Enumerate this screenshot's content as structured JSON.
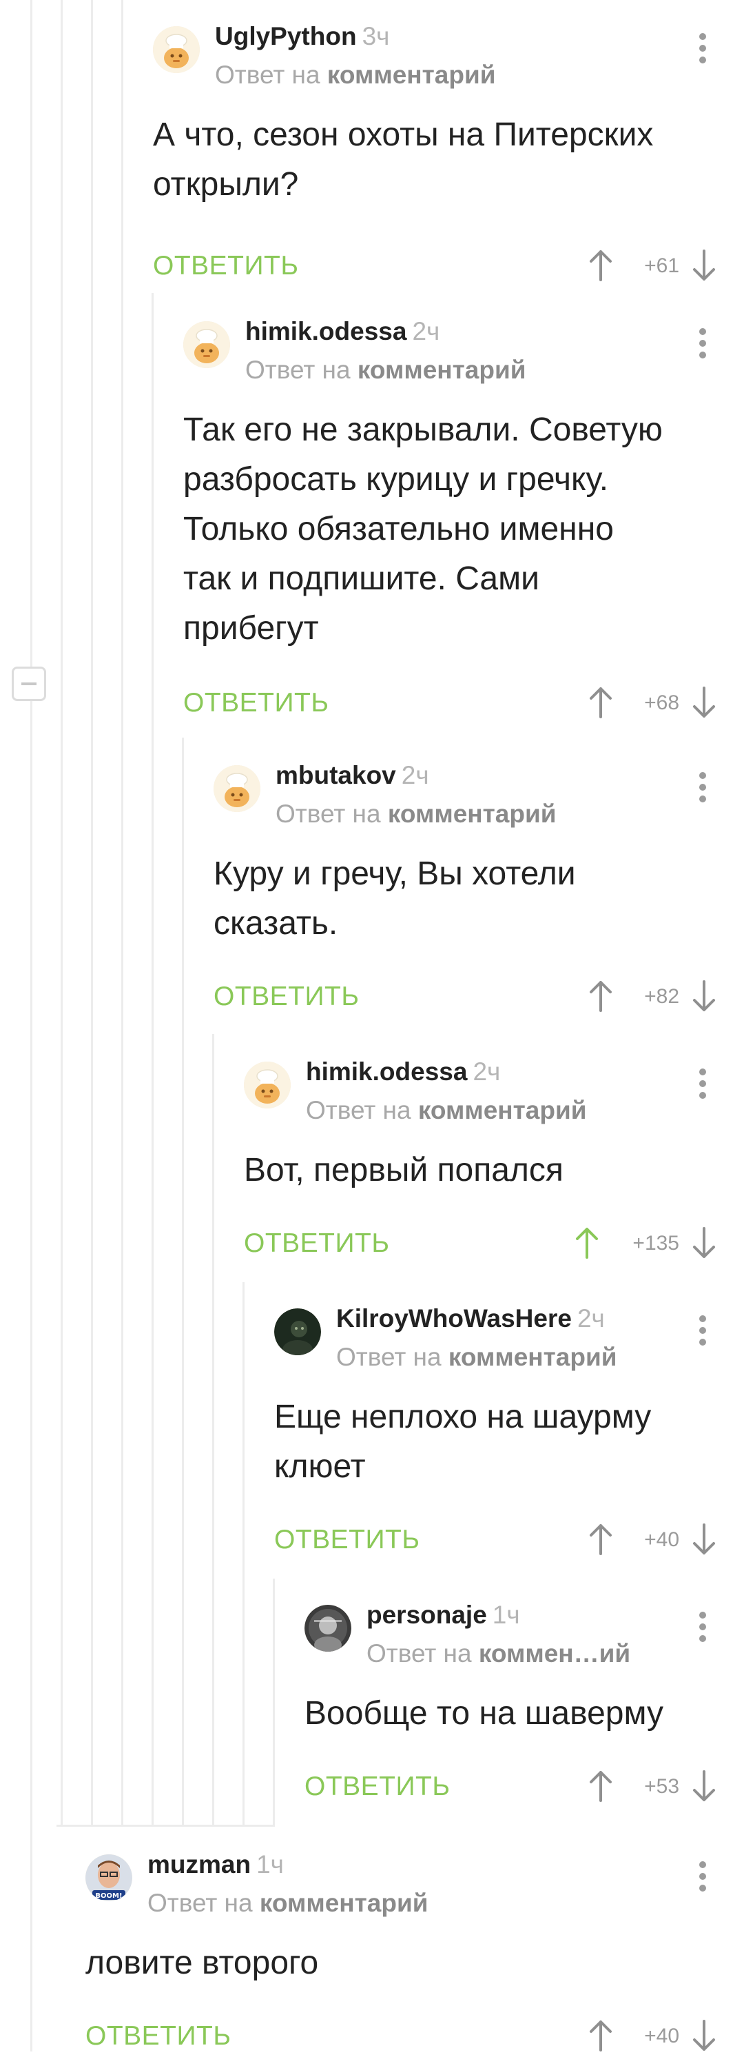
{
  "comments": [
    {
      "author": "UglyPython",
      "time": "3ч",
      "reply_prefix": "Ответ на",
      "reply_target": "комментарий",
      "lines": [
        "А что, сезон охоты на Питерских",
        "открыли?"
      ],
      "answer": "ОТВЕТИТЬ",
      "rating": "+61",
      "upvoted": false
    },
    {
      "author": "himik.odessa",
      "time": "2ч",
      "reply_prefix": "Ответ на",
      "reply_target": "комментарий",
      "lines": [
        "Так его не закрывали. Советую",
        "разбросать курицу и гречку.",
        "Только обязательно именно",
        "так и подпишите. Сами",
        "прибегут"
      ],
      "answer": "ОТВЕТИТЬ",
      "rating": "+68",
      "upvoted": false
    },
    {
      "author": "mbutakov",
      "time": "2ч",
      "reply_prefix": "Ответ на",
      "reply_target": "комментарий",
      "lines": [
        "Куру и гречу, Вы хотели",
        "сказать."
      ],
      "answer": "ОТВЕТИТЬ",
      "rating": "+82",
      "upvoted": false
    },
    {
      "author": "himik.odessa",
      "time": "2ч",
      "reply_prefix": "Ответ на",
      "reply_target": "комментарий",
      "lines": [
        "Вот, первый попался"
      ],
      "answer": "ОТВЕТИТЬ",
      "rating": "+135",
      "upvoted": true
    },
    {
      "author": "KilroyWhoWasHere",
      "time": "2ч",
      "reply_prefix": "Ответ на",
      "reply_target": "комментарий",
      "lines": [
        "Еще неплохо на шаурму",
        "клюет"
      ],
      "answer": "ОТВЕТИТЬ",
      "rating": "+40",
      "upvoted": false
    },
    {
      "author": "personaje",
      "time": "1ч",
      "reply_prefix": "Ответ на",
      "reply_target": "коммен…ий",
      "lines": [
        "Вообще то на шаверму"
      ],
      "answer": "ОТВЕТИТЬ",
      "rating": "+53",
      "upvoted": false
    },
    {
      "author": "muzman",
      "time": "1ч",
      "reply_prefix": "Ответ на",
      "reply_target": "комментарий",
      "lines": [
        "ловите второго"
      ],
      "answer": "ОТВЕТИТЬ",
      "rating": "+40",
      "upvoted": false
    }
  ],
  "avatar_badge": "BOOM!",
  "colors": {
    "accent": "#8ac858",
    "upvoted": "#8ac858",
    "icon": "#8f8f8f",
    "thread_line": "#ececec"
  },
  "icons": {
    "up": "arrow-up-icon",
    "down": "arrow-down-icon",
    "more": "more-vertical-icon",
    "collapse": "collapse-thread-icon"
  }
}
